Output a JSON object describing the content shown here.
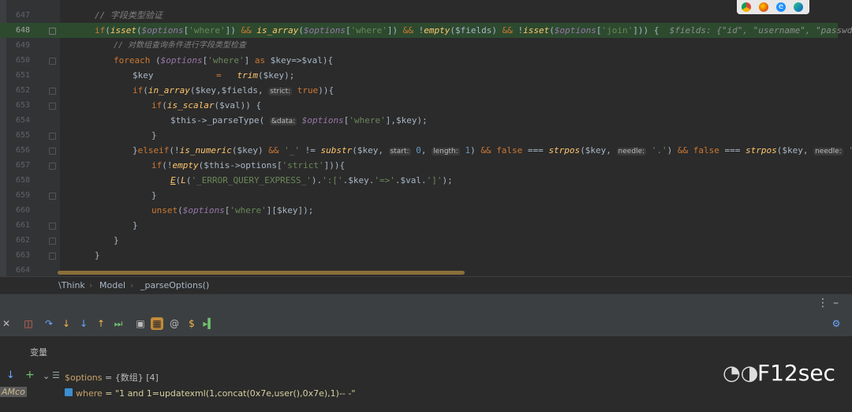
{
  "browser_icons": [
    "chrome-icon",
    "firefox-icon",
    "ie-icon",
    "edge-icon"
  ],
  "lines": [
    {
      "n": "647",
      "t": "comment"
    },
    {
      "n": "648",
      "t": "highlight"
    },
    {
      "n": "649",
      "t": "comment2"
    },
    {
      "n": "650",
      "t": "foreach"
    },
    {
      "n": "651",
      "t": "trim"
    },
    {
      "n": "652",
      "t": "inarray"
    },
    {
      "n": "653",
      "t": "isscalar"
    },
    {
      "n": "654",
      "t": "parsetype"
    },
    {
      "n": "655",
      "t": "close1"
    },
    {
      "n": "656",
      "t": "elseif"
    },
    {
      "n": "657",
      "t": "ifempty"
    },
    {
      "n": "658",
      "t": "errcall"
    },
    {
      "n": "659",
      "t": "close2"
    },
    {
      "n": "660",
      "t": "unset"
    },
    {
      "n": "661",
      "t": "close3"
    },
    {
      "n": "662",
      "t": "close4"
    },
    {
      "n": "663",
      "t": "close5"
    },
    {
      "n": "664",
      "t": "blank"
    }
  ],
  "code": {
    "c647": "// 字段类型验证",
    "c649": "// 对数组查询条件进行字段类型检查",
    "inline648": "$fields: {\"id\", \"username\", \"passwd\", _pk => \"id",
    "hint_strict": "strict:",
    "hint_data": "&data:",
    "hint_start": "start:",
    "hint_length": "length:",
    "hint_needle": "needle:"
  },
  "breadcrumb": [
    "\\Think",
    "Model",
    "_parseOptions()"
  ],
  "panel": {
    "tab_label": "变量",
    "var1_name": "$options",
    "var1_value": "= {数组} [4]",
    "var2_name": "where",
    "var2_value": "= \"1 and 1=updatexml(1,concat(0x7e,user(),0x7e),1)-- -\"",
    "side_label": "AMco"
  },
  "watermark": "F12sec",
  "colors": {
    "accent": "#c28b3a",
    "highlight": "#2d4a2f"
  }
}
